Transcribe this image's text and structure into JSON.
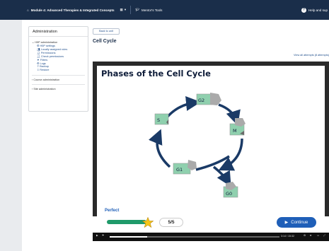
{
  "navbar": {
    "site_name": "Module 4: Advanced Therapies & Integrated Concepts",
    "tools_label": "Mentor's Tools",
    "help_label": "Help and sup",
    "grid_caret": "▾"
  },
  "sidebar": {
    "title": "Administration",
    "sections": [
      {
        "label": "H5P administration",
        "items": [
          "H5P settings",
          "Locally assigned roles",
          "Permissions",
          "Check permissions",
          "Filters",
          "Logs",
          "Backup",
          "Restore"
        ]
      },
      {
        "label": "Course administration",
        "items": []
      },
      {
        "label": "Site administration",
        "items": []
      }
    ]
  },
  "main": {
    "back_label": "Back to unit",
    "title": "Cell Cycle",
    "attempts_link": "View all attempts (8 attempts)"
  },
  "h5p": {
    "title": "Phases of the Cell Cycle",
    "nodes": [
      "S",
      "G2",
      "M",
      "G1",
      "G0"
    ],
    "feedback": "Perfect",
    "score": "5/5",
    "progress_percent": 100,
    "continue_label": "Continue"
  },
  "video": {
    "time": "3:14 / 15:32",
    "progress": 0.22
  },
  "colors": {
    "nav_bg": "#1a2e4a",
    "accent": "#1f5fb8",
    "node_green": "#7fc9a5",
    "arrow": "#1a3a66"
  }
}
